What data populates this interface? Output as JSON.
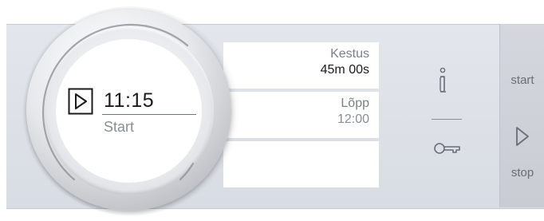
{
  "dial": {
    "time": "11:15",
    "status": "Start"
  },
  "cards": [
    {
      "label": "Kestus",
      "value": "45m 00s"
    },
    {
      "label": "Lõpp",
      "value": "12:00"
    },
    {
      "label": "",
      "value": ""
    }
  ],
  "side": {
    "start_label": "start",
    "stop_label": "stop"
  },
  "icons": {
    "info": "info-icon",
    "key": "key-icon",
    "play": "play-icon"
  },
  "colors": {
    "panel": "#dfe2e8",
    "card": "#ffffff",
    "text_primary": "#1b1b1b",
    "text_secondary": "#8a8e96"
  }
}
